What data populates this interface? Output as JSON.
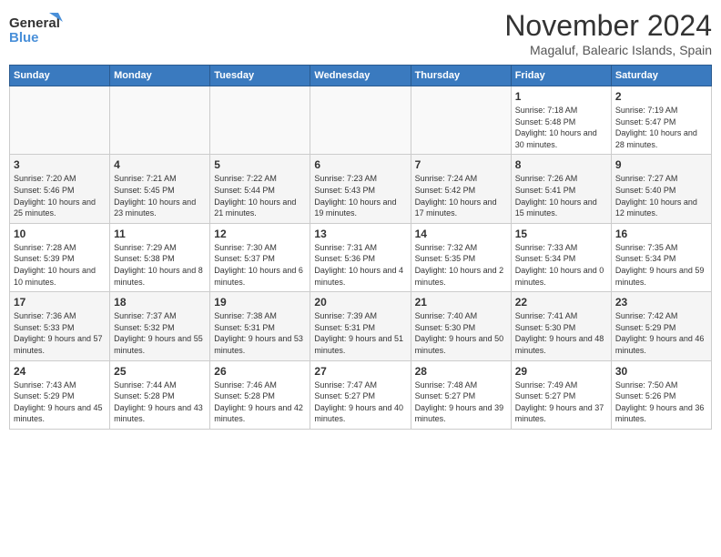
{
  "header": {
    "logo_general": "General",
    "logo_blue": "Blue",
    "month_title": "November 2024",
    "location": "Magaluf, Balearic Islands, Spain"
  },
  "weekdays": [
    "Sunday",
    "Monday",
    "Tuesday",
    "Wednesday",
    "Thursday",
    "Friday",
    "Saturday"
  ],
  "weeks": [
    [
      {
        "day": "",
        "info": ""
      },
      {
        "day": "",
        "info": ""
      },
      {
        "day": "",
        "info": ""
      },
      {
        "day": "",
        "info": ""
      },
      {
        "day": "",
        "info": ""
      },
      {
        "day": "1",
        "info": "Sunrise: 7:18 AM\nSunset: 5:48 PM\nDaylight: 10 hours and 30 minutes."
      },
      {
        "day": "2",
        "info": "Sunrise: 7:19 AM\nSunset: 5:47 PM\nDaylight: 10 hours and 28 minutes."
      }
    ],
    [
      {
        "day": "3",
        "info": "Sunrise: 7:20 AM\nSunset: 5:46 PM\nDaylight: 10 hours and 25 minutes."
      },
      {
        "day": "4",
        "info": "Sunrise: 7:21 AM\nSunset: 5:45 PM\nDaylight: 10 hours and 23 minutes."
      },
      {
        "day": "5",
        "info": "Sunrise: 7:22 AM\nSunset: 5:44 PM\nDaylight: 10 hours and 21 minutes."
      },
      {
        "day": "6",
        "info": "Sunrise: 7:23 AM\nSunset: 5:43 PM\nDaylight: 10 hours and 19 minutes."
      },
      {
        "day": "7",
        "info": "Sunrise: 7:24 AM\nSunset: 5:42 PM\nDaylight: 10 hours and 17 minutes."
      },
      {
        "day": "8",
        "info": "Sunrise: 7:26 AM\nSunset: 5:41 PM\nDaylight: 10 hours and 15 minutes."
      },
      {
        "day": "9",
        "info": "Sunrise: 7:27 AM\nSunset: 5:40 PM\nDaylight: 10 hours and 12 minutes."
      }
    ],
    [
      {
        "day": "10",
        "info": "Sunrise: 7:28 AM\nSunset: 5:39 PM\nDaylight: 10 hours and 10 minutes."
      },
      {
        "day": "11",
        "info": "Sunrise: 7:29 AM\nSunset: 5:38 PM\nDaylight: 10 hours and 8 minutes."
      },
      {
        "day": "12",
        "info": "Sunrise: 7:30 AM\nSunset: 5:37 PM\nDaylight: 10 hours and 6 minutes."
      },
      {
        "day": "13",
        "info": "Sunrise: 7:31 AM\nSunset: 5:36 PM\nDaylight: 10 hours and 4 minutes."
      },
      {
        "day": "14",
        "info": "Sunrise: 7:32 AM\nSunset: 5:35 PM\nDaylight: 10 hours and 2 minutes."
      },
      {
        "day": "15",
        "info": "Sunrise: 7:33 AM\nSunset: 5:34 PM\nDaylight: 10 hours and 0 minutes."
      },
      {
        "day": "16",
        "info": "Sunrise: 7:35 AM\nSunset: 5:34 PM\nDaylight: 9 hours and 59 minutes."
      }
    ],
    [
      {
        "day": "17",
        "info": "Sunrise: 7:36 AM\nSunset: 5:33 PM\nDaylight: 9 hours and 57 minutes."
      },
      {
        "day": "18",
        "info": "Sunrise: 7:37 AM\nSunset: 5:32 PM\nDaylight: 9 hours and 55 minutes."
      },
      {
        "day": "19",
        "info": "Sunrise: 7:38 AM\nSunset: 5:31 PM\nDaylight: 9 hours and 53 minutes."
      },
      {
        "day": "20",
        "info": "Sunrise: 7:39 AM\nSunset: 5:31 PM\nDaylight: 9 hours and 51 minutes."
      },
      {
        "day": "21",
        "info": "Sunrise: 7:40 AM\nSunset: 5:30 PM\nDaylight: 9 hours and 50 minutes."
      },
      {
        "day": "22",
        "info": "Sunrise: 7:41 AM\nSunset: 5:30 PM\nDaylight: 9 hours and 48 minutes."
      },
      {
        "day": "23",
        "info": "Sunrise: 7:42 AM\nSunset: 5:29 PM\nDaylight: 9 hours and 46 minutes."
      }
    ],
    [
      {
        "day": "24",
        "info": "Sunrise: 7:43 AM\nSunset: 5:29 PM\nDaylight: 9 hours and 45 minutes."
      },
      {
        "day": "25",
        "info": "Sunrise: 7:44 AM\nSunset: 5:28 PM\nDaylight: 9 hours and 43 minutes."
      },
      {
        "day": "26",
        "info": "Sunrise: 7:46 AM\nSunset: 5:28 PM\nDaylight: 9 hours and 42 minutes."
      },
      {
        "day": "27",
        "info": "Sunrise: 7:47 AM\nSunset: 5:27 PM\nDaylight: 9 hours and 40 minutes."
      },
      {
        "day": "28",
        "info": "Sunrise: 7:48 AM\nSunset: 5:27 PM\nDaylight: 9 hours and 39 minutes."
      },
      {
        "day": "29",
        "info": "Sunrise: 7:49 AM\nSunset: 5:27 PM\nDaylight: 9 hours and 37 minutes."
      },
      {
        "day": "30",
        "info": "Sunrise: 7:50 AM\nSunset: 5:26 PM\nDaylight: 9 hours and 36 minutes."
      }
    ]
  ]
}
